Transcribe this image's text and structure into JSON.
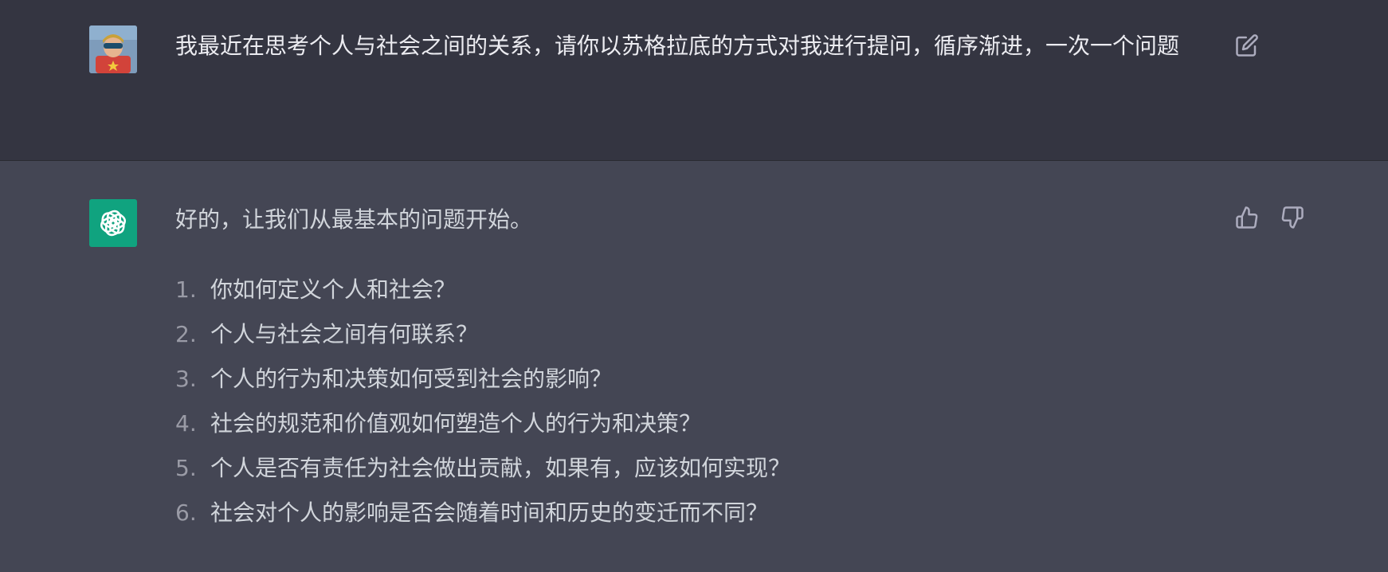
{
  "user_message": {
    "avatar": "user-avatar",
    "text": "我最近在思考个人与社会之间的关系，请你以苏格拉底的方式对我进行提问，循序渐进，一次一个问题",
    "edit_icon": "edit-icon"
  },
  "assistant_message": {
    "avatar": "openai-logo-icon",
    "intro": "好的，让我们从最基本的问题开始。",
    "items": [
      {
        "num": "1.",
        "text": "你如何定义个人和社会？"
      },
      {
        "num": "2.",
        "text": "个人与社会之间有何联系？"
      },
      {
        "num": "3.",
        "text": "个人的行为和决策如何受到社会的影响？"
      },
      {
        "num": "4.",
        "text": "社会的规范和价值观如何塑造个人的行为和决策？"
      },
      {
        "num": "5.",
        "text": "个人是否有责任为社会做出贡献，如果有，应该如何实现？"
      },
      {
        "num": "6.",
        "text": "社会对个人的影响是否会随着时间和历史的变迁而不同？"
      }
    ],
    "feedback_icons": [
      "thumbs-up-icon",
      "thumbs-down-icon"
    ]
  },
  "colors": {
    "user_bg": "#343541",
    "assistant_bg": "#444654",
    "brand_green": "#10a37f",
    "text": "#d1d5db",
    "muted": "#9a9ba6"
  }
}
